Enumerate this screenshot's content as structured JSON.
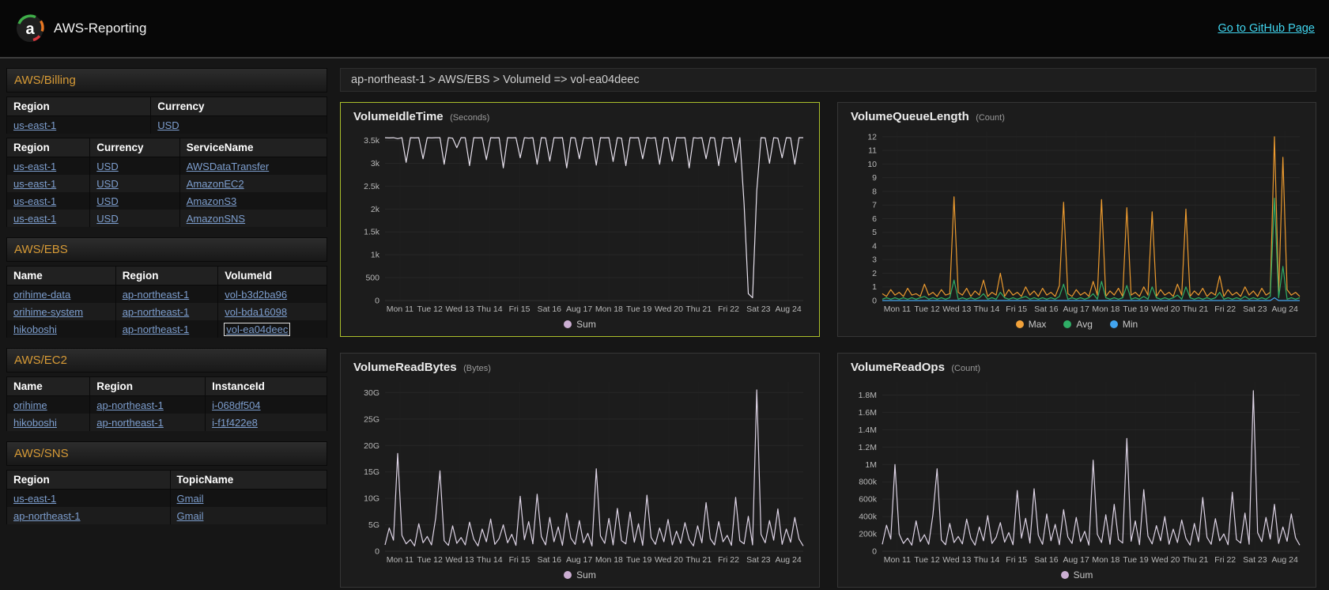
{
  "header": {
    "app_title": "AWS-Reporting",
    "github_link_label": "Go to GitHub Page"
  },
  "breadcrumb": {
    "path": "ap-northeast-1 > AWS/EBS > VolumeId => vol-ea04deec"
  },
  "sidebar": {
    "sections": [
      {
        "title": "AWS/Billing",
        "tables": [
          {
            "headers": [
              "Region",
              "Currency"
            ],
            "rows": [
              [
                "us-east-1",
                "USD"
              ]
            ]
          },
          {
            "headers": [
              "Region",
              "Currency",
              "ServiceName"
            ],
            "rows": [
              [
                "us-east-1",
                "USD",
                "AWSDataTransfer"
              ],
              [
                "us-east-1",
                "USD",
                "AmazonEC2"
              ],
              [
                "us-east-1",
                "USD",
                "AmazonS3"
              ],
              [
                "us-east-1",
                "USD",
                "AmazonSNS"
              ]
            ]
          }
        ]
      },
      {
        "title": "AWS/EBS",
        "tables": [
          {
            "headers": [
              "Name",
              "Region",
              "VolumeId"
            ],
            "rows": [
              [
                "orihime-data",
                "ap-northeast-1",
                "vol-b3d2ba96"
              ],
              [
                "orihime-system",
                "ap-northeast-1",
                "vol-bda16098"
              ],
              [
                "hikoboshi",
                "ap-northeast-1",
                "vol-ea04deec"
              ]
            ],
            "selected_cell": "vol-ea04deec"
          }
        ]
      },
      {
        "title": "AWS/EC2",
        "tables": [
          {
            "headers": [
              "Name",
              "Region",
              "InstanceId"
            ],
            "rows": [
              [
                "orihime",
                "ap-northeast-1",
                "i-068df504"
              ],
              [
                "hikoboshi",
                "ap-northeast-1",
                "i-f1f422e8"
              ]
            ]
          }
        ]
      },
      {
        "title": "AWS/SNS",
        "tables": [
          {
            "headers": [
              "Region",
              "TopicName"
            ],
            "rows": [
              [
                "us-east-1",
                "Gmail"
              ],
              [
                "ap-northeast-1",
                "Gmail"
              ]
            ]
          }
        ]
      }
    ]
  },
  "colors": {
    "accent_orange": "#d69a36",
    "link_blue": "#7d9ece",
    "github_cyan": "#41d6f0",
    "selected_panel_border": "#aabf2b",
    "series_sum": "#e7e1ed",
    "series_max": "#eb9a2f",
    "series_avg": "#2fae66",
    "series_min": "#42a5f0"
  },
  "chart_data": [
    {
      "type": "line",
      "title": "VolumeIdleTime",
      "unit": "(Seconds)",
      "selected": true,
      "legend_position": "bottom",
      "x_ticks": [
        "Mon 11",
        "Tue 12",
        "Wed 13",
        "Thu 14",
        "Fri 15",
        "Sat 16",
        "Aug 17",
        "Mon 18",
        "Tue 19",
        "Wed 20",
        "Thu 21",
        "Fri 22",
        "Sat 23",
        "Aug 24"
      ],
      "ylim": [
        0,
        3700
      ],
      "y_ticks": [
        [
          0,
          "0"
        ],
        [
          500,
          "500"
        ],
        [
          1000,
          "1k"
        ],
        [
          1500,
          "1.5k"
        ],
        [
          2000,
          "2k"
        ],
        [
          2500,
          "2.5k"
        ],
        [
          3000,
          "3k"
        ],
        [
          3500,
          "3.5k"
        ]
      ],
      "series": [
        {
          "name": "Sum",
          "color": "#e7e1ed",
          "legend_color": "#cbaed2",
          "values": [
            3560,
            3555,
            3560,
            3540,
            3560,
            3020,
            3560,
            3555,
            3560,
            3100,
            3560,
            3555,
            3560,
            3560,
            2980,
            3560,
            3550,
            3340,
            3560,
            3560,
            2950,
            3560,
            3555,
            3560,
            3080,
            3560,
            3555,
            3560,
            2900,
            3560,
            3555,
            3560,
            3120,
            3560,
            3550,
            3560,
            2980,
            3560,
            3555,
            3050,
            3560,
            3555,
            3560,
            2900,
            3560,
            3555,
            3100,
            3560,
            3550,
            3560,
            2960,
            3560,
            3555,
            3560,
            3040,
            3560,
            3550,
            2950,
            3560,
            3555,
            3560,
            3100,
            3560,
            3550,
            3560,
            2980,
            3560,
            3555,
            3050,
            3560,
            3555,
            3560,
            2900,
            3560,
            3550,
            3560,
            3100,
            3560,
            3555,
            2950,
            3560,
            3550,
            3560,
            3020,
            3560,
            2100,
            150,
            60,
            2400,
            3560,
            3555,
            3000,
            3560,
            3550,
            3120,
            3560,
            3555,
            2980,
            3560,
            3560
          ]
        }
      ]
    },
    {
      "type": "line",
      "title": "VolumeQueueLength",
      "unit": "(Count)",
      "selected": false,
      "legend_position": "bottom",
      "x_ticks": [
        "Mon 11",
        "Tue 12",
        "Wed 13",
        "Thu 14",
        "Fri 15",
        "Sat 16",
        "Aug 17",
        "Mon 18",
        "Tue 19",
        "Wed 20",
        "Thu 21",
        "Fri 22",
        "Sat 23",
        "Aug 24"
      ],
      "ylim": [
        0,
        12.4
      ],
      "y_ticks": [
        [
          0,
          "0"
        ],
        [
          1,
          "1"
        ],
        [
          2,
          "2"
        ],
        [
          3,
          "3"
        ],
        [
          4,
          "4"
        ],
        [
          5,
          "5"
        ],
        [
          6,
          "6"
        ],
        [
          7,
          "7"
        ],
        [
          8,
          "8"
        ],
        [
          9,
          "9"
        ],
        [
          10,
          "10"
        ],
        [
          11,
          "11"
        ],
        [
          12,
          "12"
        ]
      ],
      "series": [
        {
          "name": "Max",
          "color": "#eb9a2f",
          "legend_color": "#f2a23a",
          "values": [
            0.5,
            0.3,
            0.8,
            0.4,
            0.6,
            0.3,
            0.9,
            0.4,
            0.5,
            0.3,
            1.2,
            0.4,
            0.6,
            0.3,
            0.8,
            0.4,
            0.5,
            7.6,
            0.6,
            0.4,
            0.9,
            0.3,
            0.7,
            0.4,
            1.5,
            0.3,
            0.6,
            0.4,
            2.0,
            0.3,
            0.8,
            0.4,
            0.6,
            0.3,
            1.0,
            0.4,
            0.7,
            0.3,
            0.9,
            0.4,
            0.6,
            0.3,
            1.1,
            7.2,
            0.5,
            0.3,
            0.8,
            0.4,
            0.6,
            0.3,
            1.4,
            0.4,
            7.4,
            0.3,
            0.7,
            0.4,
            0.9,
            0.3,
            6.8,
            0.4,
            0.6,
            0.3,
            1.0,
            0.4,
            6.5,
            0.3,
            0.8,
            0.4,
            0.6,
            0.3,
            1.2,
            0.4,
            6.7,
            0.3,
            0.7,
            0.4,
            0.9,
            0.3,
            0.6,
            0.4,
            1.8,
            0.3,
            0.8,
            0.4,
            0.6,
            0.3,
            1.0,
            0.4,
            0.7,
            0.3,
            0.9,
            0.4,
            0.6,
            12.0,
            0.5,
            10.5,
            0.8,
            0.4,
            0.6,
            0.3
          ]
        },
        {
          "name": "Avg",
          "color": "#2fae66",
          "legend_color": "#2fae66",
          "values": [
            0.1,
            0.2,
            0.1,
            0.2,
            0.1,
            0.2,
            0.1,
            0.2,
            0.1,
            0.2,
            0.3,
            0.1,
            0.2,
            0.1,
            0.2,
            0.1,
            0.2,
            1.5,
            0.1,
            0.2,
            0.1,
            0.2,
            0.1,
            0.2,
            0.5,
            0.1,
            0.2,
            0.1,
            0.6,
            0.2,
            0.1,
            0.2,
            0.1,
            0.2,
            0.3,
            0.1,
            0.2,
            0.1,
            0.2,
            0.1,
            0.2,
            0.1,
            0.3,
            1.2,
            0.1,
            0.2,
            0.1,
            0.2,
            0.1,
            0.2,
            0.5,
            0.1,
            1.4,
            0.2,
            0.1,
            0.2,
            0.1,
            0.2,
            1.1,
            0.1,
            0.2,
            0.1,
            0.3,
            0.1,
            1.0,
            0.2,
            0.1,
            0.2,
            0.1,
            0.2,
            0.4,
            0.1,
            1.0,
            0.2,
            0.1,
            0.2,
            0.1,
            0.2,
            0.1,
            0.2,
            0.6,
            0.1,
            0.2,
            0.1,
            0.2,
            0.1,
            0.3,
            0.1,
            0.2,
            0.1,
            0.2,
            0.1,
            0.3,
            7.5,
            0.2,
            2.5,
            0.1,
            0.2,
            0.1,
            0.2
          ]
        },
        {
          "name": "Min",
          "color": "#42a5f0",
          "legend_color": "#42a5f0",
          "values": [
            0,
            0,
            0,
            0,
            0,
            0,
            0,
            0,
            0,
            0,
            0,
            0,
            0,
            0,
            0,
            0,
            0,
            0,
            0,
            0,
            0,
            0,
            0,
            0,
            0,
            0,
            0,
            0,
            0,
            0,
            0,
            0,
            0,
            0,
            0,
            0,
            0,
            0,
            0,
            0,
            0,
            0,
            0,
            0,
            0,
            0,
            0,
            0,
            0,
            0,
            0,
            0,
            0,
            0,
            0,
            0,
            0,
            0,
            0,
            0,
            0,
            0,
            0,
            0,
            0,
            0,
            0,
            0,
            0,
            0,
            0,
            0,
            0,
            0,
            0,
            0,
            0,
            0,
            0,
            0,
            0,
            0,
            0,
            0,
            0,
            0,
            0,
            0,
            0,
            0,
            0,
            0,
            0,
            0.2,
            0,
            0,
            0,
            0,
            0,
            0
          ]
        }
      ]
    },
    {
      "type": "line",
      "title": "VolumeReadBytes",
      "unit": "(Bytes)",
      "selected": false,
      "legend_position": "bottom",
      "x_ticks": [
        "Mon 11",
        "Tue 12",
        "Wed 13",
        "Thu 14",
        "Fri 15",
        "Sat 16",
        "Aug 17",
        "Mon 18",
        "Tue 19",
        "Wed 20",
        "Thu 21",
        "Fri 22",
        "Sat 23",
        "Aug 24"
      ],
      "ylim": [
        0,
        32
      ],
      "y_unit_scale": "G",
      "y_ticks": [
        [
          0,
          "0"
        ],
        [
          5,
          "5G"
        ],
        [
          10,
          "10G"
        ],
        [
          15,
          "15G"
        ],
        [
          20,
          "20G"
        ],
        [
          25,
          "25G"
        ],
        [
          30,
          "30G"
        ]
      ],
      "series": [
        {
          "name": "Sum",
          "color": "#ded4e6",
          "legend_color": "#cbaed2",
          "values": [
            1.2,
            4.4,
            2.1,
            18.5,
            3.0,
            1.4,
            2.2,
            1.0,
            5.2,
            1.6,
            2.8,
            1.2,
            6.3,
            15.2,
            2.0,
            1.1,
            4.8,
            1.5,
            2.6,
            1.2,
            5.5,
            2.3,
            1.0,
            4.2,
            1.8,
            6.1,
            1.3,
            2.4,
            5.0,
            1.6,
            3.2,
            1.1,
            10.4,
            2.2,
            5.6,
            1.4,
            10.8,
            2.8,
            1.2,
            6.4,
            1.8,
            4.6,
            1.1,
            7.2,
            2.5,
            1.3,
            5.8,
            1.6,
            3.4,
            1.0,
            15.6,
            2.9,
            1.5,
            6.2,
            1.2,
            8.1,
            2.0,
            1.4,
            7.4,
            1.7,
            5.2,
            1.1,
            10.6,
            2.6,
            1.3,
            4.4,
            1.8,
            6.0,
            1.2,
            3.8,
            1.5,
            5.4,
            2.2,
            1.0,
            4.8,
            1.6,
            9.2,
            2.4,
            1.2,
            5.6,
            1.8,
            3.0,
            1.1,
            10.2,
            2.0,
            1.4,
            6.6,
            1.2,
            30.5,
            3.2,
            1.6,
            5.8,
            2.1,
            8.0,
            1.3,
            4.2,
            1.7,
            6.4,
            2.3,
            1.0
          ]
        }
      ]
    },
    {
      "type": "line",
      "title": "VolumeReadOps",
      "unit": "(Count)",
      "selected": false,
      "legend_position": "bottom",
      "x_ticks": [
        "Mon 11",
        "Tue 12",
        "Wed 13",
        "Thu 14",
        "Fri 15",
        "Sat 16",
        "Aug 17",
        "Mon 18",
        "Tue 19",
        "Wed 20",
        "Thu 21",
        "Fri 22",
        "Sat 23",
        "Aug 24"
      ],
      "ylim": [
        0,
        1950
      ],
      "y_unit_scale": "k",
      "y_ticks": [
        [
          0,
          "0"
        ],
        [
          200,
          "200k"
        ],
        [
          400,
          "400k"
        ],
        [
          600,
          "600k"
        ],
        [
          800,
          "800k"
        ],
        [
          1000,
          "1M"
        ],
        [
          1200,
          "1.2M"
        ],
        [
          1400,
          "1.4M"
        ],
        [
          1600,
          "1.6M"
        ],
        [
          1800,
          "1.8M"
        ]
      ],
      "series": [
        {
          "name": "Sum",
          "color": "#ded4e6",
          "legend_color": "#cbaed2",
          "values": [
            80,
            300,
            140,
            1000,
            200,
            90,
            150,
            70,
            350,
            110,
            190,
            80,
            420,
            950,
            130,
            75,
            320,
            100,
            170,
            85,
            370,
            150,
            70,
            280,
            120,
            410,
            90,
            160,
            330,
            105,
            215,
            75,
            700,
            150,
            380,
            95,
            720,
            185,
            80,
            430,
            120,
            310,
            75,
            480,
            165,
            90,
            390,
            110,
            230,
            70,
            1050,
            195,
            100,
            420,
            80,
            540,
            135,
            95,
            1300,
            115,
            350,
            75,
            710,
            175,
            85,
            295,
            120,
            400,
            80,
            255,
            100,
            360,
            150,
            70,
            320,
            110,
            620,
            160,
            80,
            375,
            120,
            200,
            75,
            680,
            135,
            95,
            440,
            80,
            1850,
            215,
            110,
            390,
            140,
            540,
            90,
            280,
            115,
            430,
            155,
            70
          ]
        }
      ]
    }
  ]
}
